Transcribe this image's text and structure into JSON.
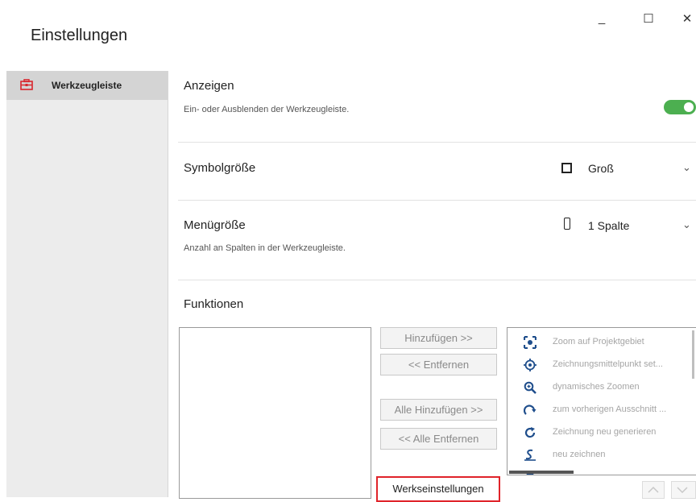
{
  "window": {
    "title": "Einstellungen",
    "minimize_glyph": "_",
    "maximize_glyph": "☐",
    "close_glyph": "✕"
  },
  "sidebar": {
    "items": [
      {
        "label": "Werkzeugleiste",
        "icon": "toolbox-icon",
        "selected": true
      }
    ]
  },
  "settings": {
    "show": {
      "title": "Anzeigen",
      "description": "Ein- oder Ausblenden der Werkzeugleiste.",
      "enabled": true
    },
    "icon_size": {
      "title": "Symbolgröße",
      "value": "Groß"
    },
    "menu_size": {
      "title": "Menügröße",
      "description": "Anzahl an Spalten in der Werkzeugleiste.",
      "value": "1 Spalte"
    }
  },
  "functions": {
    "title": "Funktionen",
    "buttons": {
      "add": "Hinzufügen >>",
      "remove": "<< Entfernen",
      "add_all": "Alle Hinzufügen >>",
      "remove_all": "<< Alle Entfernen",
      "factory": "Werkseinstellungen"
    },
    "available": [
      {
        "label": "Zoom auf Projektgebiet",
        "icon": "zoom-extents-icon"
      },
      {
        "label": "Zeichnungsmittelpunkt set...",
        "icon": "target-center-icon"
      },
      {
        "label": "dynamisches Zoomen",
        "icon": "zoom-icon"
      },
      {
        "label": "zum vorherigen Ausschnitt ...",
        "icon": "previous-view-icon"
      },
      {
        "label": "Zeichnung neu generieren",
        "icon": "regenerate-icon"
      },
      {
        "label": "neu zeichnen",
        "icon": "redraw-icon"
      }
    ]
  },
  "colors": {
    "accent_green": "#4caf50",
    "highlight_red": "#e0232a",
    "icon_blue": "#1f4e8c",
    "toolbox_red": "#d9262d"
  }
}
